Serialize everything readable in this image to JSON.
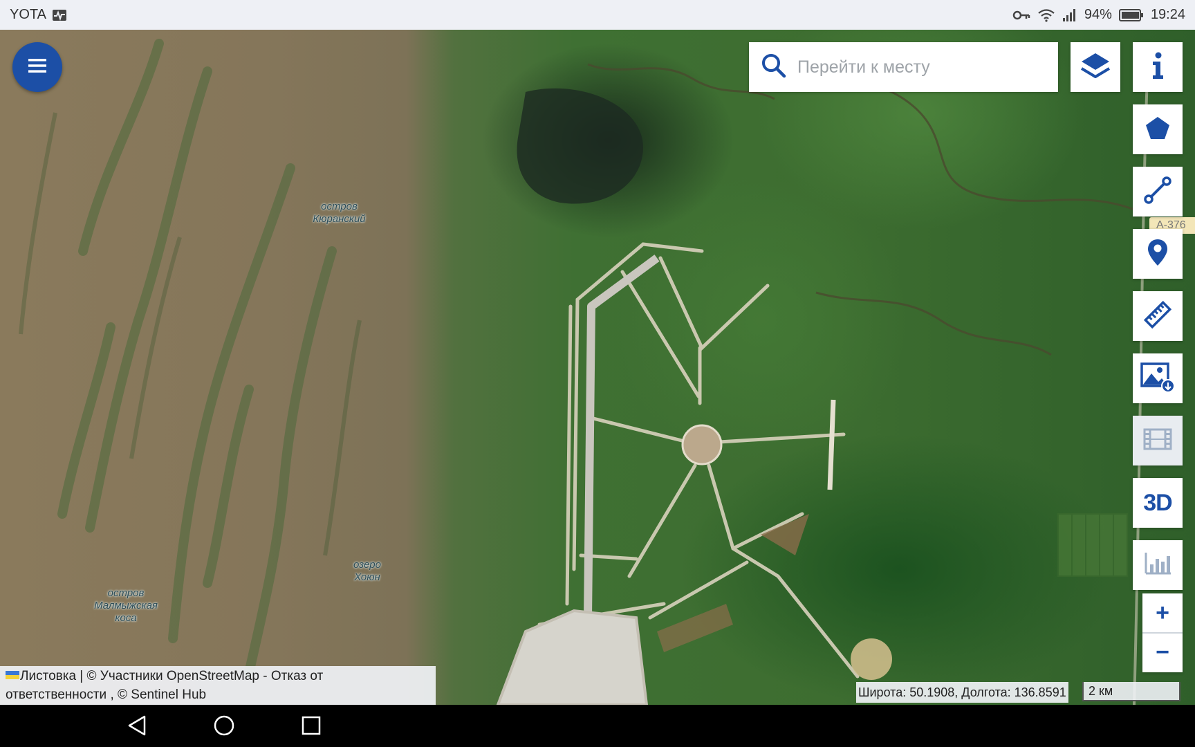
{
  "status_bar": {
    "carrier": "YOTA",
    "battery": "94%",
    "time": "19:24",
    "icons": [
      "activity-icon",
      "key-icon",
      "wifi-icon",
      "signal-icon",
      "battery-icon"
    ]
  },
  "map": {
    "labels": [
      {
        "line1": "остров",
        "line2": "Кюранский",
        "line3": ""
      },
      {
        "line1": "озеро",
        "line2": "Хоюн",
        "line3": ""
      },
      {
        "line1": "остров",
        "line2": "Малмыжская",
        "line3": "коса"
      }
    ],
    "road_shield": "А-376"
  },
  "search": {
    "placeholder": "Перейти к месту",
    "value": ""
  },
  "tools": {
    "info": "info-icon",
    "polygon": "pentagon-icon",
    "line": "line-draw-icon",
    "marker": "map-pin-icon",
    "measure": "ruler-icon",
    "download": "image-download-icon",
    "timelapse": "film-icon",
    "three_d_label": "3D",
    "statistics": "bar-chart-icon"
  },
  "zoom": {
    "in_label": "+",
    "out_label": "−"
  },
  "attribution": {
    "line1": "Листовка | © Участники OpenStreetMap - Отказ от",
    "line2": "ответственности , © Sentinel Hub"
  },
  "coordinates": "Широта: 50.1908, Долгота: 136.8591",
  "scale": "2 км",
  "colors": {
    "accent": "#1c4fa6",
    "status_bar_bg": "#eef0f5",
    "nav_bar_bg": "#000000"
  },
  "nav_bar": {
    "icons": [
      "back-icon",
      "home-icon",
      "recents-icon"
    ]
  }
}
